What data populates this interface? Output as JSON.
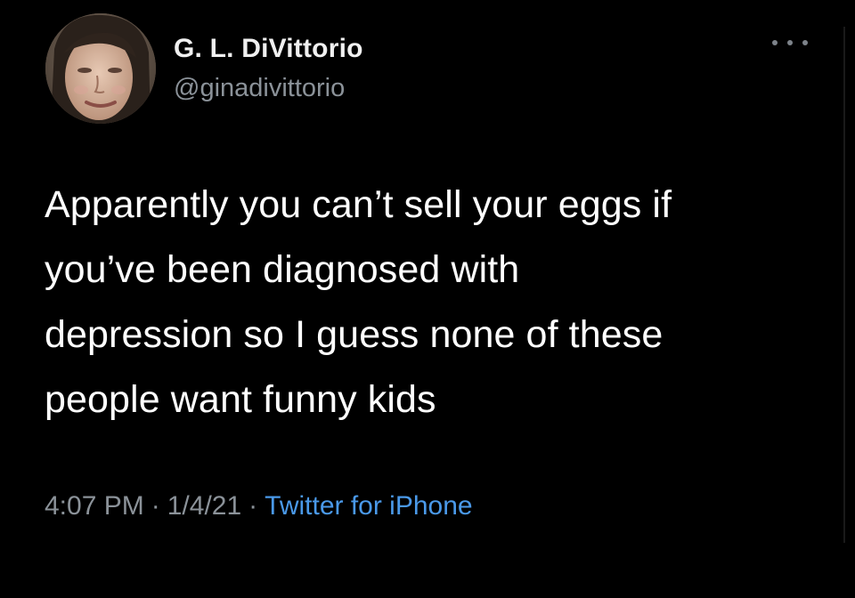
{
  "tweet": {
    "author": {
      "display_name": "G. L. DiVittorio",
      "handle": "@ginadivittorio"
    },
    "text_lines": [
      "Apparently you can’t sell your eggs if",
      "you’ve been diagnosed with",
      "depression so I guess none of these",
      "people want funny kids"
    ],
    "time": "4:07 PM",
    "date": "1/4/21",
    "separator": "·",
    "source": "Twitter for iPhone",
    "more_icon": "more-horizontal-icon"
  },
  "colors": {
    "background": "#000000",
    "text": "#ffffff",
    "secondary": "#8b9299",
    "link": "#4a99e9"
  }
}
